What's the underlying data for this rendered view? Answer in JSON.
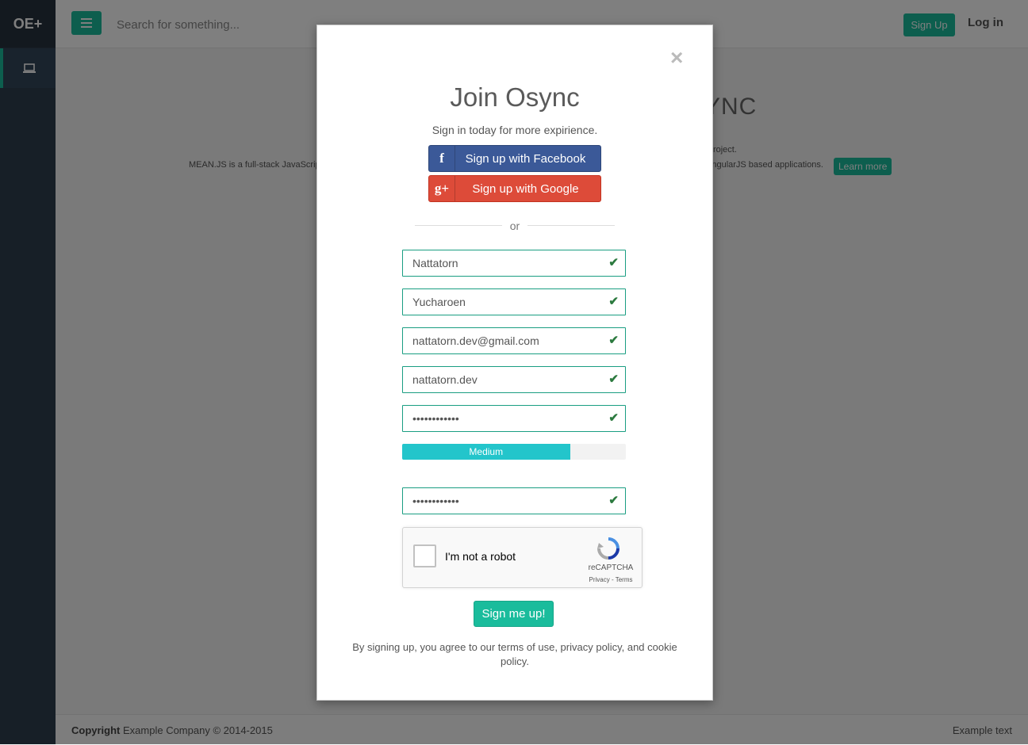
{
  "app": {
    "brand": "OE+"
  },
  "topbar": {
    "search_placeholder": "Search for something...",
    "signup_label": "Sign Up",
    "login_label": "Log in"
  },
  "hero": {
    "title_fragment": "YNC",
    "line1_fragment": "ur project.",
    "line2_left_fragment": "MEAN.JS is a full-stack JavaScrip",
    "line2_right_fragment": "AngularJS based applications.",
    "learn_more": "Learn more"
  },
  "footer": {
    "copyright_bold": "Copyright",
    "copyright_rest": " Example Company © 2014-2015",
    "right_text": "Example text"
  },
  "modal": {
    "close": "×",
    "title": "Join Osync",
    "subtitle": "Sign in today for more expirience.",
    "facebook_label": "Sign up with Facebook",
    "google_label": "Sign up with Google",
    "facebook_icon_glyph": "f",
    "google_icon_glyph": "g+",
    "or_text": "or",
    "fields": {
      "first_name": "Nattatorn",
      "last_name": "Yucharoen",
      "email": "nattatorn.dev@gmail.com",
      "username": "nattatorn.dev",
      "password": "password1234",
      "confirm_password": "password1234"
    },
    "check_glyph": "✔",
    "password_strength": {
      "label": "Medium",
      "percent": 75
    },
    "captcha": {
      "label": "I'm not a robot",
      "brand": "reCAPTCHA",
      "links": "Privacy - Terms"
    },
    "submit_label": "Sign me up!",
    "terms": "By signing up, you agree to our terms of use, privacy policy, and cookie policy."
  },
  "colors": {
    "accent": "#1abc9c",
    "facebook": "#3b5998",
    "google": "#dd4b39",
    "strength": "#23c5cb",
    "sidebar": "#2e3e4f"
  },
  "icons": {
    "menu": "hamburger-icon",
    "sidebar_item": "laptop-icon",
    "close": "close-icon",
    "valid": "check-icon"
  }
}
